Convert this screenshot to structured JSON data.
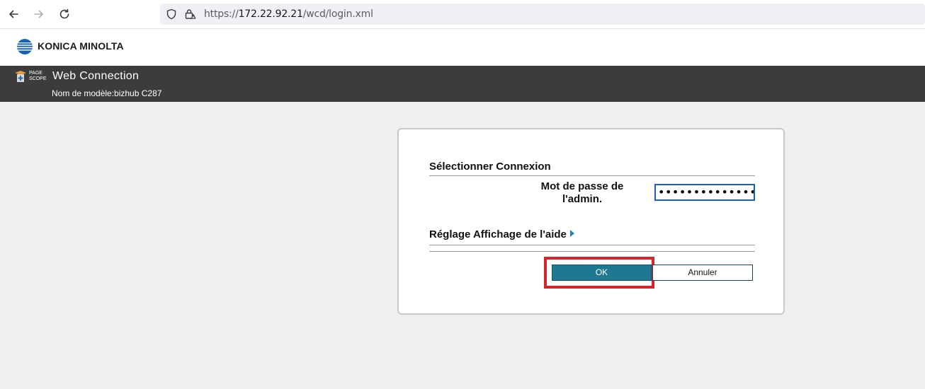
{
  "browser": {
    "url_scheme": "https://",
    "url_host": "172.22.92.21",
    "url_path": "/wcd/login.xml"
  },
  "brand": {
    "name": "KONICA MINOLTA",
    "accent_color": "#1a5fb4"
  },
  "app_header": {
    "logo_text_top": "PAGE",
    "logo_text_bottom": "SCOPE",
    "title": "Web Connection",
    "model_label": "Nom de modèle:bizhub C287"
  },
  "login": {
    "section_title": "Sélectionner Connexion",
    "password_label_line1": "Mot de passe de",
    "password_label_line2": "l'admin.",
    "password_value": "••••••••••••••",
    "help_setting_label": "Réglage Affichage de l'aide",
    "ok_label": "OK",
    "cancel_label": "Annuler",
    "highlight_color": "#d9242c"
  }
}
